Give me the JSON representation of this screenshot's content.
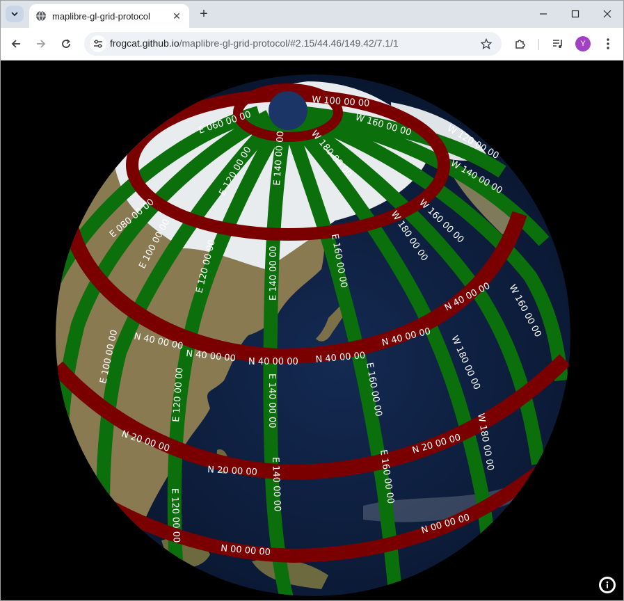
{
  "browser": {
    "tab_title": "maplibre-gl-grid-protocol",
    "url_host": "frogcat.github.io",
    "url_path": "/maplibre-gl-grid-protocol/#2.15/44.46/149.42/7.1/1",
    "profile_initial": "Y",
    "tab_search_icon": "chevron-down-icon",
    "new_tab_symbol": "+",
    "close_tab_symbol": "✕"
  },
  "map": {
    "longitude_labels": [
      "E 100 00 00",
      "E 120 00 00",
      "E 140 00 00",
      "E 160 00 00",
      "W 180 00 00",
      "W 160 00 00",
      "W 140 00 00"
    ],
    "latitude_labels": [
      "N 40 00 00",
      "N 20 00 00",
      "N 00 00 00"
    ],
    "polar_labels": [
      "E 060 00 00",
      "E 080 00 00",
      "W 100 00 00",
      "W 120 00 00"
    ],
    "grid_colors": {
      "meridian": "#0b6f0b",
      "parallel": "#7a0000",
      "ocean": "#0c1c3a",
      "land": "#8a7a52",
      "snow": "#e8ecef"
    }
  },
  "attribution_icon": "info-icon"
}
